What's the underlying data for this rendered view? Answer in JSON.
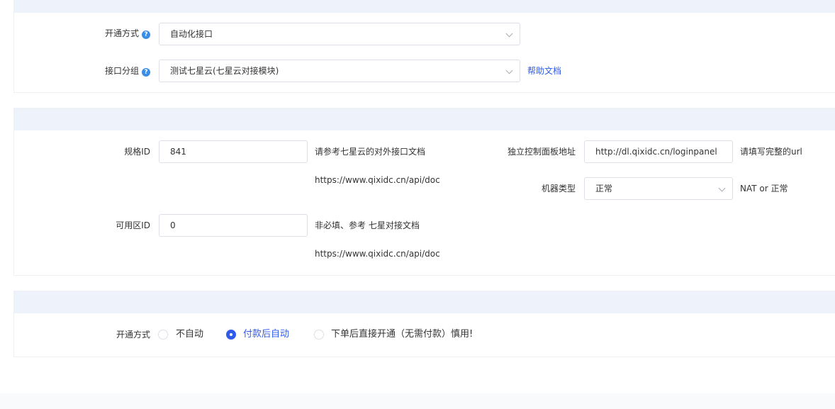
{
  "section1": {
    "open_method_label": "开通方式",
    "open_method_value": "自动化接口",
    "group_label": "接口分组",
    "group_value": "测试七星云(七星云对接模块)",
    "help_doc_link": "帮助文档"
  },
  "section2": {
    "spec_label": "规格ID",
    "spec_value": "841",
    "spec_note": "请参考七星云的对外接口文档",
    "spec_url": "https://www.qixidc.cn/api/doc",
    "zone_label": "可用区ID",
    "zone_value": "0",
    "zone_note": "非必填、参考 七星对接文档",
    "zone_url": "https://www.qixidc.cn/api/doc",
    "panel_label": "独立控制面板地址",
    "panel_value": "http://dl.qixidc.cn/loginpanel",
    "panel_note": "请填写完整的url",
    "machine_label": "机器类型",
    "machine_value": "正常",
    "machine_note": "NAT or 正常"
  },
  "section3": {
    "open_method_label": "开通方式",
    "options": [
      {
        "label": "不自动",
        "selected": false
      },
      {
        "label": "付款后自动",
        "selected": true
      },
      {
        "label": "下单后直接开通（无需付款）慎用!",
        "selected": false
      }
    ]
  },
  "colors": {
    "accent": "#2f5bea",
    "help_icon": "#3a8ee6",
    "section_header": "#eef2fb"
  }
}
